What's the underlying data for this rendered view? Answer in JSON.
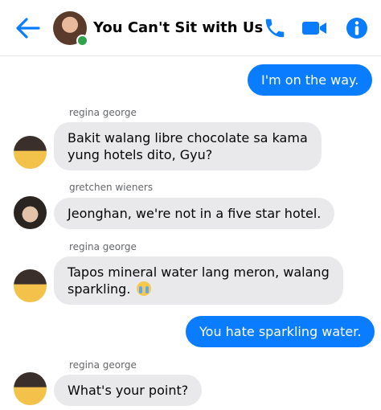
{
  "header": {
    "title": "You Can't Sit with Us",
    "icons": {
      "back": "arrow-left-icon",
      "phone": "phone-icon",
      "video": "video-camera-icon",
      "info": "info-icon"
    },
    "online": true
  },
  "colors": {
    "accent": "#0a7cff",
    "incoming_bubble": "#e9e9eb",
    "online": "#31a24c"
  },
  "messages": [
    {
      "direction": "outgoing",
      "text": "I'm on the way."
    },
    {
      "direction": "incoming",
      "sender": "regina george",
      "lines": [
        "Bakit walang libre chocolate sa kama",
        "yung hotels dito, Gyu?"
      ]
    },
    {
      "direction": "incoming",
      "sender": "gretchen wieners",
      "text": "Jeonghan, we're not in a five star hotel."
    },
    {
      "direction": "incoming",
      "sender": "regina george",
      "lines": [
        "Tapos mineral water lang meron, walang",
        "sparkling."
      ],
      "emoji": "crying-face-emoji"
    },
    {
      "direction": "outgoing",
      "text": "You hate sparkling water."
    },
    {
      "direction": "incoming",
      "sender": "regina george",
      "text": "What's your point?"
    }
  ]
}
